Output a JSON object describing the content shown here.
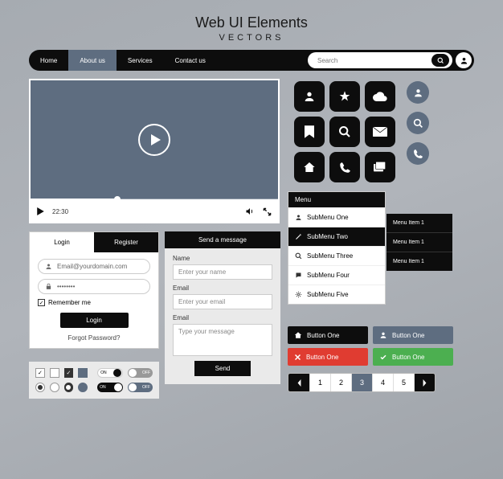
{
  "header": {
    "title": "Web UI Elements",
    "subtitle": "VECTORS"
  },
  "nav": {
    "items": [
      "Home",
      "About us",
      "Services",
      "Contact us"
    ],
    "active_index": 1,
    "search_placeholder": "Search"
  },
  "video": {
    "timestamp": "22:30"
  },
  "icon_grid": [
    "person",
    "star",
    "cloud",
    "bookmark",
    "search",
    "mail",
    "home",
    "phone",
    "cards"
  ],
  "circle_icons": [
    "person",
    "search",
    "phone"
  ],
  "login": {
    "tabs": [
      "Login",
      "Register"
    ],
    "active_tab": 0,
    "email_placeholder": "Email@yourdomain.com",
    "password_value": "••••••••",
    "remember_label": "Remember me",
    "remember_checked": true,
    "submit_label": "Login",
    "forgot_label": "Forgot Password?"
  },
  "contact": {
    "title": "Send a message",
    "fields": [
      {
        "label": "Name",
        "placeholder": "Enter your name"
      },
      {
        "label": "Email",
        "placeholder": "Enter your email"
      },
      {
        "label": "Email",
        "placeholder": "Type your message"
      }
    ],
    "submit_label": "Send"
  },
  "menu": {
    "title": "Menu",
    "items": [
      {
        "icon": "person",
        "label": "SubMenu One"
      },
      {
        "icon": "pencil",
        "label": "SubMenu Two"
      },
      {
        "icon": "search",
        "label": "SubMenu Three"
      },
      {
        "icon": "chat",
        "label": "SubMenu Four"
      },
      {
        "icon": "gear",
        "label": "SubMenu Five"
      }
    ],
    "active_index": 1,
    "submenu": [
      "Menu Item 1",
      "Menu Item 1",
      "Menu Item 1"
    ]
  },
  "buttons": [
    {
      "icon": "home",
      "label": "Button One",
      "color": "black"
    },
    {
      "icon": "person",
      "label": "Button One",
      "color": "slate"
    },
    {
      "icon": "close",
      "label": "Button One",
      "color": "red"
    },
    {
      "icon": "check",
      "label": "Button One",
      "color": "green"
    }
  ],
  "pagination": {
    "pages": [
      "1",
      "2",
      "3",
      "4",
      "5"
    ],
    "active_index": 2
  },
  "toggles": {
    "on_label": "ON",
    "off_label": "OFF"
  }
}
